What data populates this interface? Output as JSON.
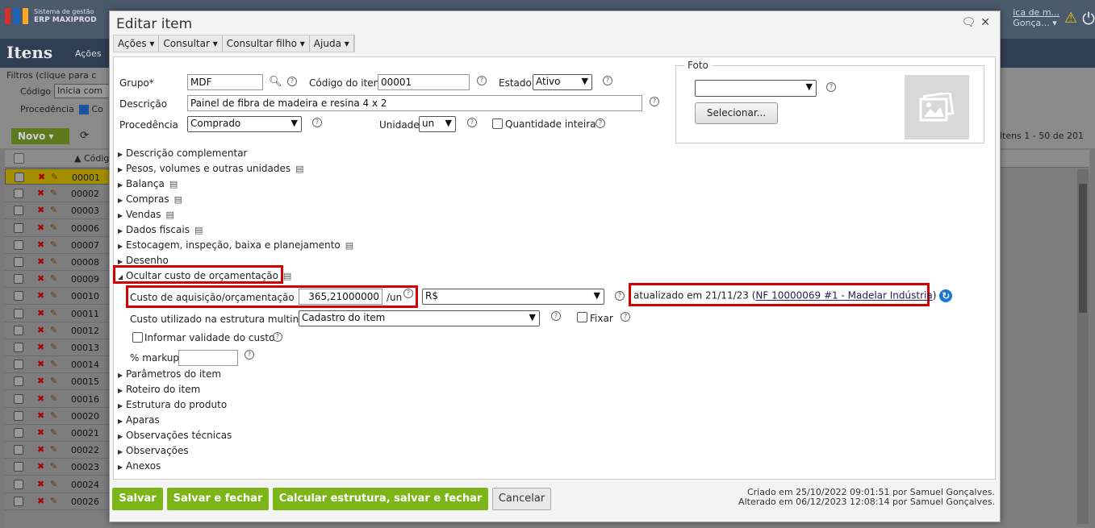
{
  "app": {
    "logo_line1": "Sistema de gestão",
    "logo_line2": "ERP MAXIPROD",
    "top_right_link1": "ica de m...",
    "top_right_link2": "Gonça... ▾",
    "page_title": "Itens",
    "page_actions": "Ações",
    "filters_label": "Filtros (clique para c",
    "filter_codigo_label": "Código",
    "filter_codigo_value": "Inicia com",
    "filter_procedencia_label": "Procedência",
    "filter_procedencia_value": "Co",
    "new_button": "Novo",
    "column_code": "▲ Códig",
    "items_count": "Itens 1 - 50 de 201",
    "rows": [
      "00001",
      "00002",
      "00003",
      "00006",
      "00007",
      "00008",
      "00009",
      "00010",
      "00011",
      "00012",
      "00013",
      "00014",
      "00015",
      "00016",
      "00020",
      "00021",
      "00022",
      "00023",
      "00024",
      "00026"
    ]
  },
  "dialog": {
    "title": "Editar item",
    "menus": [
      "Ações ▾",
      "Consultar ▾",
      "Consultar filho ▾",
      "Ajuda ▾"
    ],
    "grupo_label": "Grupo*",
    "grupo_value": "MDF",
    "codigo_label": "Código do item",
    "codigo_value": "00001",
    "estado_label": "Estado",
    "estado_value": "Ativo",
    "descricao_label": "Descrição",
    "descricao_value": "Painel de fibra de madeira e resina 4 x 2",
    "procedencia_label": "Procedência",
    "procedencia_value": "Comprado",
    "unidade_label": "Unidade",
    "unidade_value": "un",
    "qtd_inteira_label": "Quantidade inteira",
    "foto_label": "Foto",
    "foto_select_value": "",
    "selecionar_button": "Selecionar...",
    "sections_top": [
      "Descrição complementar",
      "Pesos, volumes e outras unidades",
      "Balança",
      "Compras",
      "Vendas",
      "Dados fiscais",
      "Estocagem, inspeção, baixa e planejamento",
      "Desenho"
    ],
    "cost_section": "Ocultar custo de orçamentação",
    "custo_label": "Custo de aquisição/orçamentação",
    "custo_value": "365,21000000",
    "custo_unit": "/un",
    "moeda_value": "R$",
    "atualizado_text": "atualizado em 21/11/23 (",
    "atualizado_link": "NF 10000069 #1 - Madelar Indústria",
    "atualizado_close": ")",
    "custo_estrutura_label": "Custo utilizado na estrutura multinível",
    "custo_estrutura_value": "Cadastro do item",
    "fixar_label": "Fixar",
    "validade_label": "Informar validade do custo",
    "markup_label": "% markup",
    "markup_value": "",
    "sections_bottom": [
      "Parâmetros do item",
      "Roteiro do item",
      "Estrutura do produto",
      "Aparas",
      "Observações técnicas",
      "Observações",
      "Anexos"
    ],
    "btn_salvar": "Salvar",
    "btn_salvar_fechar": "Salvar e fechar",
    "btn_calcular": "Calcular estrutura, salvar e fechar",
    "btn_cancelar": "Cancelar",
    "criado": "Criado em 25/10/2022 09:01:51 por Samuel Gonçalves.",
    "alterado": "Alterado em 06/12/2023 12:08:14 por Samuel Gonçalves."
  }
}
